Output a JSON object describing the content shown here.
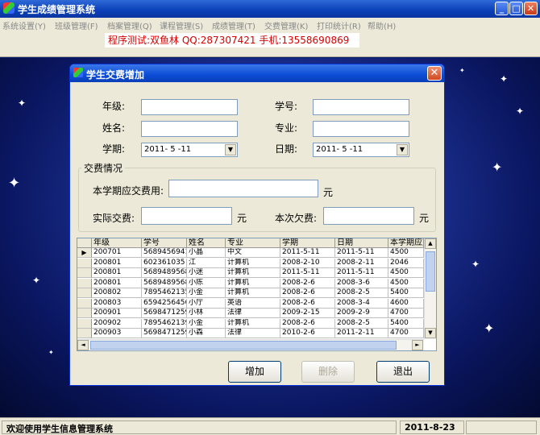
{
  "window": {
    "title": "学生成绩管理系统",
    "min": "_",
    "max": "□",
    "close": "✕"
  },
  "menu": [
    "系统设置(Y)",
    "班级管理(F)",
    "档案管理(Q)",
    "课程管理(S)",
    "成绩管理(T)",
    "交费管理(K)",
    "打印统计(R)",
    "帮助(H)"
  ],
  "info": "程序测试:双鱼林 QQ:287307421 手机:13558690869",
  "dialog": {
    "title": "学生交费增加",
    "close": "✕",
    "labels": {
      "grade": "年级:",
      "student_no": "学号:",
      "name": "姓名:",
      "major": "专业:",
      "term": "学期:",
      "date": "日期:"
    },
    "values": {
      "grade": "",
      "student_no": "",
      "name": "",
      "major": "",
      "term": "2011- 5 -11",
      "date": "2011- 5 -11"
    },
    "group": {
      "title": "交费情况",
      "fee_label": "本学期应交费用:",
      "paid_label": "实际交费:",
      "owed_label": "本次欠费:",
      "unit": "元"
    },
    "grid": {
      "columns": [
        "年级",
        "学号",
        "姓名",
        "专业",
        "学期",
        "日期",
        "本学期应交"
      ],
      "rows": [
        [
          "200701",
          "5689456941",
          "小晶",
          "中文",
          "2011-5-11",
          "2011-5-11",
          "4500"
        ],
        [
          "200801",
          "602361035",
          "江",
          "计算机",
          "2008-2-10",
          "2008-2-11",
          "2046"
        ],
        [
          "200801",
          "5689489568",
          "小迷",
          "计算机",
          "2011-5-11",
          "2011-5-11",
          "4500"
        ],
        [
          "200801",
          "5689489568",
          "小陈",
          "计算机",
          "2008-2-6",
          "2008-3-6",
          "4500"
        ],
        [
          "200802",
          "7895462135",
          "小金",
          "计算机",
          "2008-2-6",
          "2008-2-5",
          "5400"
        ],
        [
          "200803",
          "6594256456",
          "小厅",
          "英语",
          "2008-2-6",
          "2008-3-4",
          "4600"
        ],
        [
          "200901",
          "5698471259",
          "小林",
          "法律",
          "2009-2-15",
          "2009-2-9",
          "4700"
        ],
        [
          "200902",
          "7895462139",
          "小金",
          "计算机",
          "2008-2-6",
          "2008-2-5",
          "5400"
        ],
        [
          "200903",
          "5698471259",
          "小森",
          "法律",
          "2010-2-6",
          "2011-2-11",
          "4700"
        ]
      ]
    },
    "buttons": {
      "add": "增加",
      "delete": "删除",
      "exit": "退出"
    }
  },
  "status": {
    "welcome": "欢迎使用学生信息管理系统",
    "date": "2011-8-23"
  }
}
